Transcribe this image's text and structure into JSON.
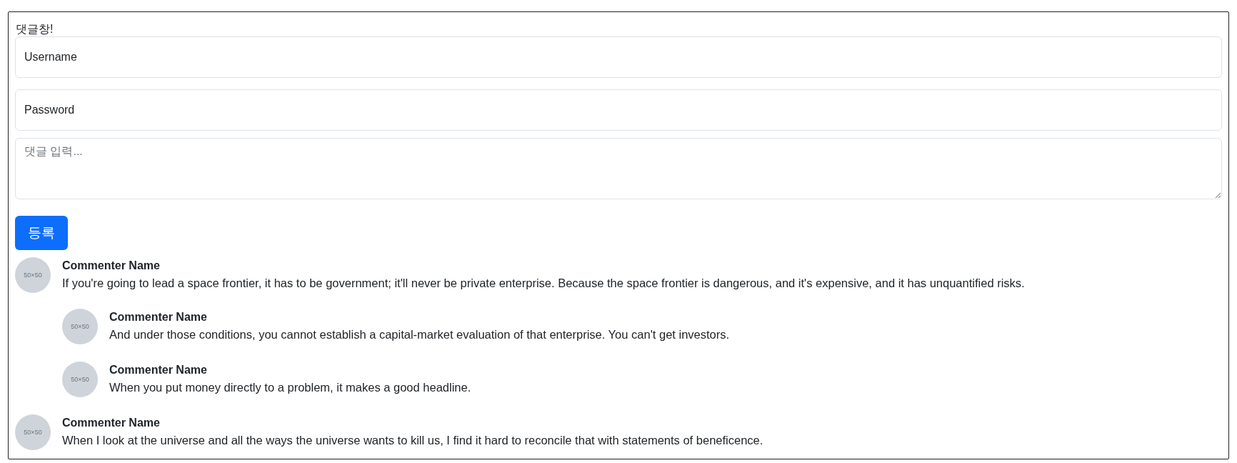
{
  "title": "댓글창!",
  "form": {
    "username": {
      "placeholder": "Username"
    },
    "password": {
      "placeholder": "Password"
    },
    "comment": {
      "placeholder": "댓글 입력..."
    },
    "submit": "등록"
  },
  "comments": [
    {
      "avatar_label": "50×50",
      "name": "Commenter Name",
      "text": "If you're going to lead a space frontier, it has to be government; it'll never be private enterprise. Because the space frontier is dangerous, and it's expensive, and it has unquantified risks.",
      "children": [
        {
          "avatar_label": "50×50",
          "name": "Commenter Name",
          "text": "And under those conditions, you cannot establish a capital-market evaluation of that enterprise. You can't get investors."
        },
        {
          "avatar_label": "50×50",
          "name": "Commenter Name",
          "text": "When you put money directly to a problem, it makes a good headline."
        }
      ]
    },
    {
      "avatar_label": "50×50",
      "name": "Commenter Name",
      "text": "When I look at the universe and all the ways the universe wants to kill us, I find it hard to reconcile that with statements of beneficence."
    }
  ]
}
